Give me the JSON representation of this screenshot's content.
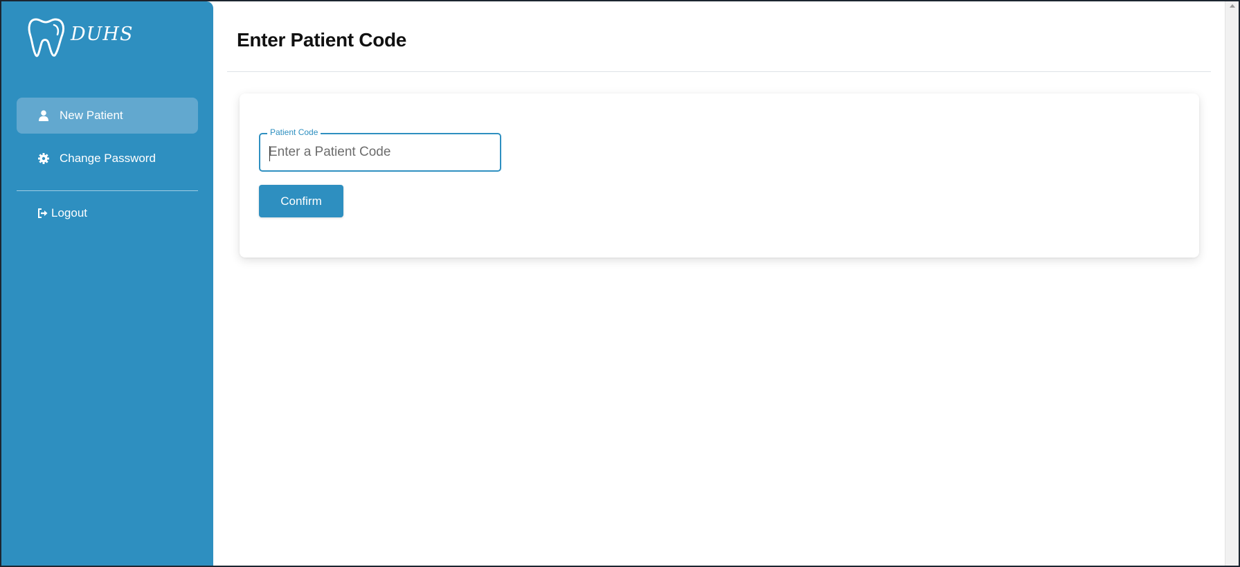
{
  "brand": {
    "logo_text": "DUHS"
  },
  "sidebar": {
    "items": [
      {
        "label": "New Patient",
        "icon": "user-icon",
        "active": true
      },
      {
        "label": "Change Password",
        "icon": "gear-icon",
        "active": false
      }
    ],
    "logout_label": "Logout",
    "logout_icon": "sign-out-icon"
  },
  "main": {
    "title": "Enter Patient Code",
    "form": {
      "field_label": "Patient Code",
      "placeholder": "Enter a Patient Code",
      "value": "",
      "confirm_label": "Confirm"
    }
  },
  "colors": {
    "sidebar_bg": "#2e8fc0",
    "active_item_bg": "#62a8cf",
    "accent": "#2e8fc0"
  }
}
